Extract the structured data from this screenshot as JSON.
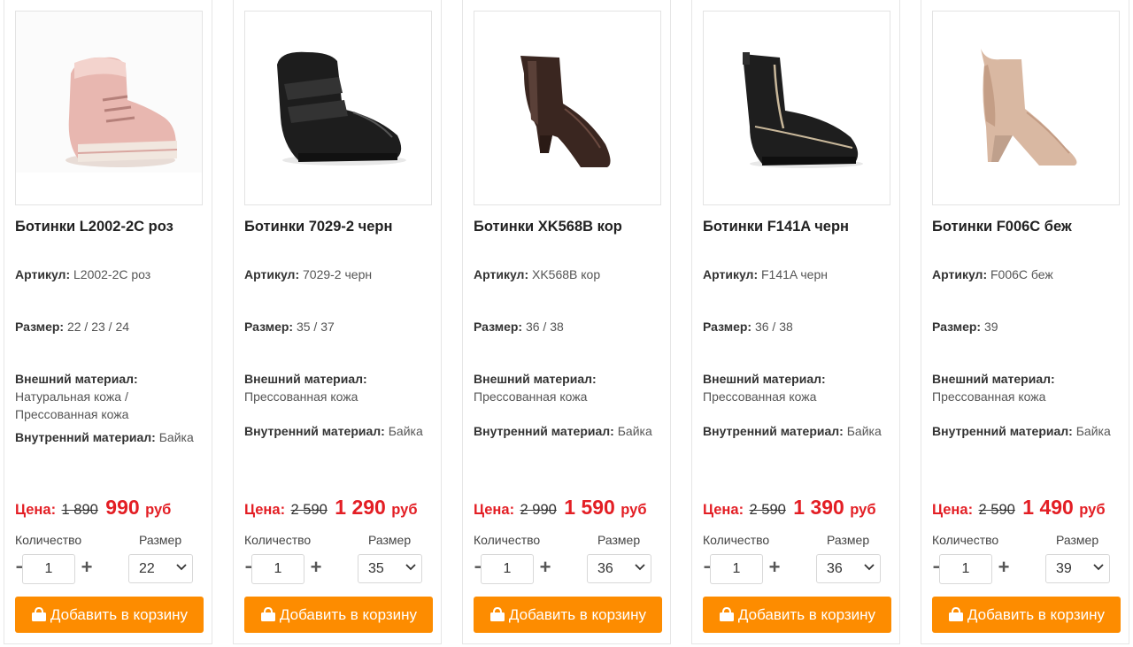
{
  "labels": {
    "article": "Артикул:",
    "size": "Размер:",
    "outer_material": "Внешний материал:",
    "inner_material": "Внутренний материал:",
    "price": "Цена:",
    "currency": "руб",
    "quantity": "Количество",
    "size_select": "Размер",
    "add_to_cart": "Добавить в корзину"
  },
  "colors": {
    "accent": "#fd8c00",
    "price": "#e31e24"
  },
  "products": [
    {
      "title": "Ботинки L2002-2C роз",
      "article": "L2002-2C роз",
      "sizes": "22 / 23 / 24",
      "outer": "Натуральная кожа / Прессованная кожа",
      "inner": "Байка",
      "old_price": "1 890",
      "new_price": "990",
      "qty": "1",
      "size_selected": "22",
      "image": "pink-kids-boot"
    },
    {
      "title": "Ботинки 7029-2 черн",
      "article": "7029-2 черн",
      "sizes": "35 / 37",
      "outer": "Прессованная кожа",
      "inner": "Байка",
      "old_price": "2 590",
      "new_price": "1 290",
      "qty": "1",
      "size_selected": "35",
      "image": "black-velcro-boot"
    },
    {
      "title": "Ботинки XK568B кор",
      "article": "XK568B кор",
      "sizes": "36 / 38",
      "outer": "Прессованная кожа",
      "inner": "Байка",
      "old_price": "2 990",
      "new_price": "1 590",
      "qty": "1",
      "size_selected": "36",
      "image": "brown-heel-boot"
    },
    {
      "title": "Ботинки F141A черн",
      "article": "F141A черн",
      "sizes": "36 / 38",
      "outer": "Прессованная кожа",
      "inner": "Байка",
      "old_price": "2 590",
      "new_price": "1 390",
      "qty": "1",
      "size_selected": "36",
      "image": "black-chelsea-boot"
    },
    {
      "title": "Ботинки F006C беж",
      "article": "F006C беж",
      "sizes": "39",
      "outer": "Прессованная кожа",
      "inner": "Байка",
      "old_price": "2 590",
      "new_price": "1 490",
      "qty": "1",
      "size_selected": "39",
      "image": "beige-wedge-boot"
    }
  ]
}
